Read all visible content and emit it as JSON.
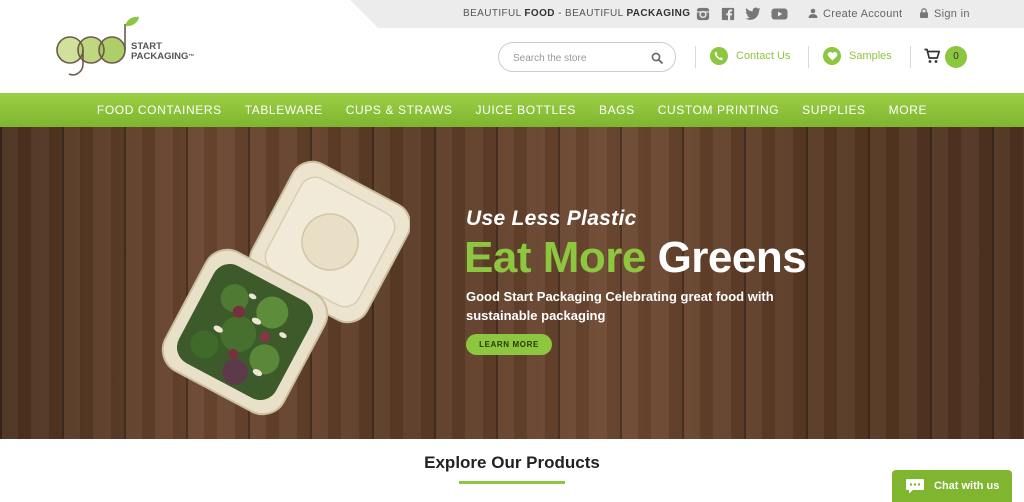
{
  "topbar": {
    "tagline_prefix": "BEAUTIFUL ",
    "tagline_bold1": "FOOD",
    "tagline_middle": " - BEAUTIFUL ",
    "tagline_bold2": "PACKAGING",
    "social_icons": [
      "instagram-icon",
      "facebook-icon",
      "twitter-icon",
      "youtube-icon"
    ],
    "create_account": "Create Account",
    "sign_in": "Sign in"
  },
  "header": {
    "logo_line1": "START",
    "logo_line2": "PACKAGING",
    "logo_tm": "™",
    "search_placeholder": "Search the store",
    "contact_label": "Contact Us",
    "samples_label": "Samples",
    "cart_count": "0"
  },
  "nav": {
    "items": [
      "FOOD CONTAINERS",
      "TABLEWARE",
      "CUPS & STRAWS",
      "JUICE BOTTLES",
      "BAGS",
      "CUSTOM PRINTING",
      "SUPPLIES",
      "MORE"
    ]
  },
  "hero": {
    "subtitle": "Use Less Plastic",
    "title_green": "Eat More",
    "title_white": "Greens",
    "description": "Good Start Packaging Celebrating great food with sustainable packaging",
    "button": "LEARN MORE"
  },
  "explore": {
    "title": "Explore Our Products"
  },
  "chat": {
    "label": "Chat with us"
  },
  "colors": {
    "accent": "#8dc63f",
    "nav_dark": "#7fb52f",
    "wood": "#5a3a25"
  }
}
